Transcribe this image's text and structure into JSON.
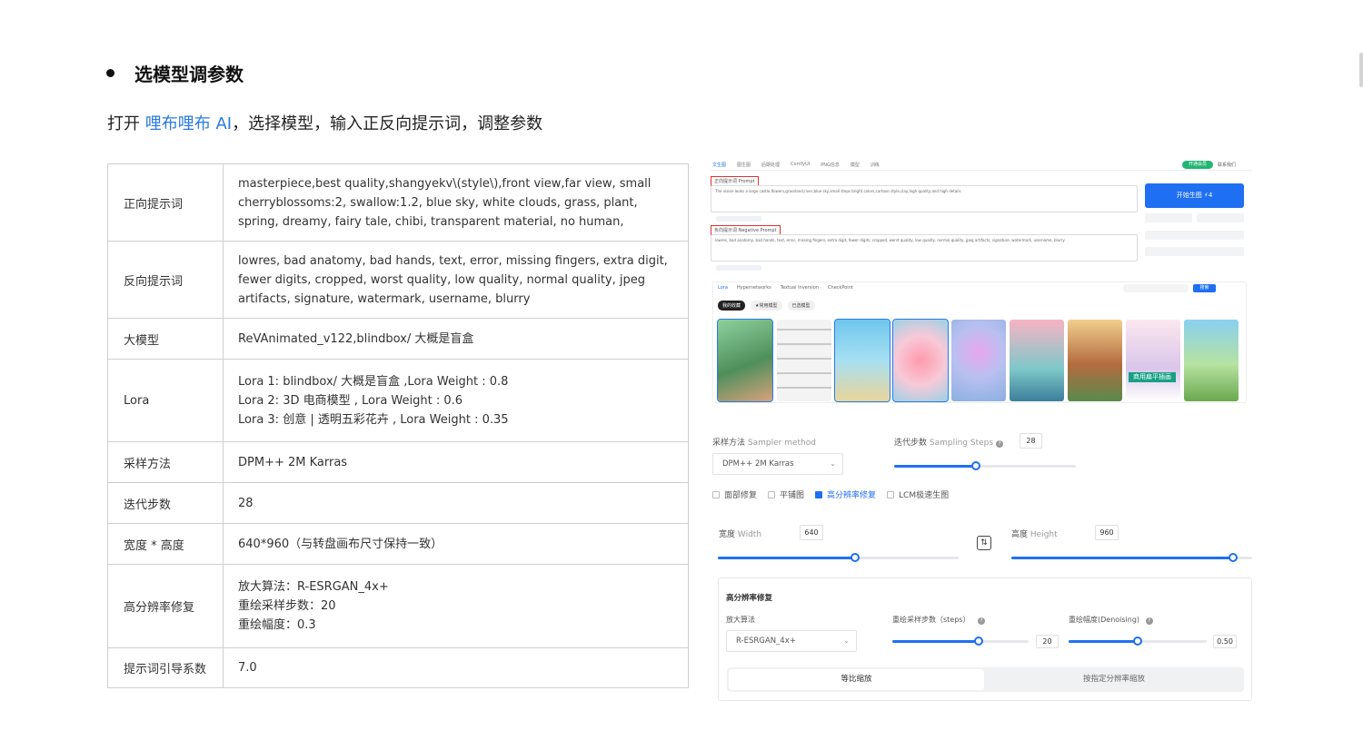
{
  "heading": "选模型调参数",
  "intro": {
    "prefix": "打开 ",
    "link": "哩布哩布 AI",
    "suffix": "，选择模型，输入正反向提示词，调整参数"
  },
  "table": {
    "positive_key": "正向提示词",
    "positive_val": "masterpiece,best quality,shangyekv\\(style\\),front view,far view, small cherryblossoms:2, swallow:1.2, blue sky, white clouds, grass, plant, spring, dreamy, fairy tale, chibi, transparent material, no human,",
    "negative_key": "反向提示词",
    "negative_val": "lowres, bad anatomy, bad hands, text, error, missing fingers, extra digit, fewer digits, cropped, worst quality, low quality, normal quality, jpeg artifacts, signature, watermark, username, blurry",
    "model_key": "大模型",
    "model_val": "ReVAnimated_v122,blindbox/ 大概是盲盒",
    "lora_key": "Lora",
    "lora_1": "Lora 1: blindbox/ 大概是盲盒 ,Lora Weight : 0.8",
    "lora_2": "Lora 2: 3D 电商模型 , Lora Weight : 0.6",
    "lora_3": "Lora 3: 创意 | 透明五彩花卉 , Lora Weight : 0.35",
    "sampler_key": "采样方法",
    "sampler_val": "DPM++ 2M Karras",
    "steps_key": "迭代步数",
    "steps_val": "28",
    "size_key": "宽度 * 高度",
    "size_val": "640*960（与转盘画布尺寸保持一致）",
    "hires_key": "高分辨率修复",
    "hires_1": "放大算法：R-ESRGAN_4x+",
    "hires_2": "重绘采样步数：20",
    "hires_3": "重绘幅度：0.3",
    "cfg_key": "提示词引导系数",
    "cfg_val": "7.0"
  },
  "screenshot": {
    "nav_tabs": [
      "文生图",
      "图生图",
      "后期处理",
      "ComfyUI",
      "PNG信息",
      "模型",
      "训练"
    ],
    "green_pill": "开通会员",
    "grey_pill": "联系我们",
    "prompt_label": "正向提示词 Prompt",
    "prompt_text": "The vision looks a large castle,flowers,grassland,river,blue sky,small steps bright colors,cartoon style,clay,high quality,and high details",
    "neg_label": "负向提示词 Negative Prompt",
    "neg_text": "lowres, bad anatomy, bad hands, text, error, missing fingers, extra digit, fewer digits, cropped, worst quality, low quality, normal quality, jpeg artifacts, signature, watermark, username, blurry",
    "generate_button": "开始生图 ⚡4",
    "panel_tabs": [
      "Lora",
      "Hypernetworks",
      "Textual Inversion",
      "CheckPoint"
    ],
    "chips": [
      "我的收藏",
      "★常用模型",
      "已选模型"
    ],
    "search_btn": "搜索",
    "thumb_banner": "商用扁平插画",
    "sampler_label": "采样方法",
    "sampler_label_en": "Sampler method",
    "sampler_value": "DPM++ 2M Karras",
    "steps_label": "迭代步数",
    "steps_label_en": "Sampling Steps",
    "steps_value": "28",
    "steps_fraction": 0.45,
    "checkboxes": [
      {
        "label": "面部修复",
        "checked": false
      },
      {
        "label": "平铺图",
        "checked": false
      },
      {
        "label": "高分辨率修复",
        "checked": true
      },
      {
        "label": "LCM极速生图",
        "checked": false
      }
    ],
    "width_label": "宽度",
    "width_label_en": "Width",
    "width_value": "640",
    "width_fraction": 0.57,
    "height_label": "高度",
    "height_label_en": "Height",
    "height_value": "960",
    "height_fraction": 0.92,
    "hires_title": "高分辨率修复",
    "upscaler_label": "放大算法",
    "upscaler_value": "R-ESRGAN_4x+",
    "hires_steps_label": "重绘采样步数（steps）",
    "hires_steps_value": "20",
    "hires_steps_fraction": 0.63,
    "denoise_label": "重绘幅度(Denoising)",
    "denoise_value": "0.50",
    "denoise_fraction": 0.5,
    "toggle_on": "等比缩放",
    "toggle_off": "按指定分辨率缩放",
    "accent": "#1f6ff2",
    "highlight_box": "#e0312f"
  }
}
